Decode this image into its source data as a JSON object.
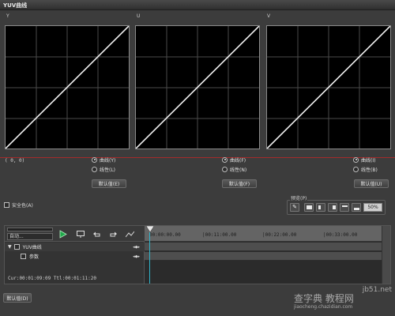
{
  "window": {
    "title": "YUV曲线"
  },
  "panels": [
    {
      "label": "Y",
      "radio_curve": "曲线(Y)",
      "radio_linear": "线性(L)",
      "default_button": "默认值(E)",
      "selected": "curve"
    },
    {
      "label": "U",
      "radio_curve": "曲线(F)",
      "radio_linear": "线性(N)",
      "default_button": "默认值(F)",
      "selected": "curve"
    },
    {
      "label": "V",
      "radio_curve": "曲线(I)",
      "radio_linear": "线性(B)",
      "default_button": "默认值(U)",
      "selected": "curve"
    }
  ],
  "coordinates": "( 0, 0)",
  "safe_color": {
    "label": "安全色(A)",
    "checked": false
  },
  "preview": {
    "label": "预览(P)",
    "zoom": "50%"
  },
  "timeline": {
    "mode_select": "自动...",
    "ruler_ticks": [
      "00:00:00.00",
      "|00:11:00.00",
      "|00:22:00.00",
      "|00:33:00.00"
    ],
    "tracks": [
      {
        "label": "YUV曲线",
        "expanded": true
      },
      {
        "label": "参数",
        "expanded": false
      }
    ],
    "status": "Cur:00:01:09:09 Ttl:00:01:11:20"
  },
  "footer": {
    "default_button": "默认值(D)"
  },
  "watermark": {
    "line1": "jb51.net",
    "line2": "查字典 教程网",
    "line3": "jiaocheng.chazidian.com"
  }
}
